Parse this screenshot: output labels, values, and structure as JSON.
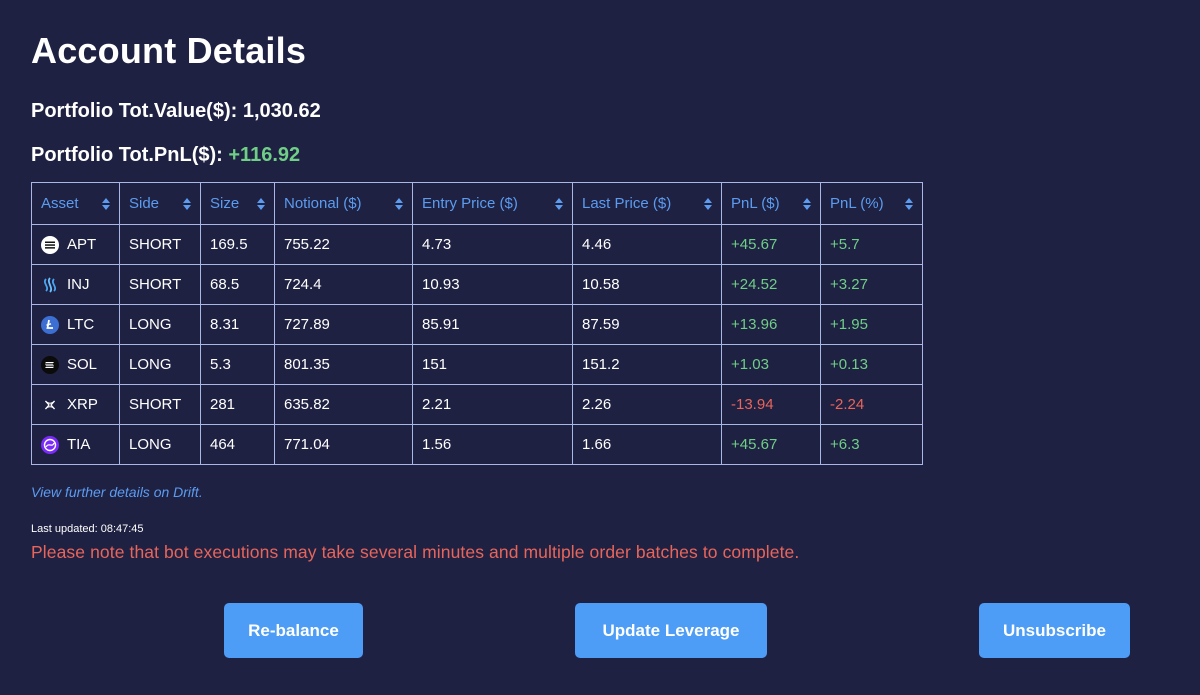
{
  "page": {
    "title": "Account Details",
    "portfolio_value_label": "Portfolio Tot.Value($):",
    "portfolio_value": "1,030.62",
    "portfolio_pnl_label": "Portfolio Tot.PnL($):",
    "portfolio_pnl": "+116.92"
  },
  "table": {
    "headers": [
      "Asset",
      "Side",
      "Size",
      "Notional ($)",
      "Entry Price ($)",
      "Last Price ($)",
      "PnL ($)",
      "PnL (%)"
    ],
    "rows": [
      {
        "asset": "APT",
        "icon": "aptos-icon",
        "side": "SHORT",
        "size": "169.5",
        "notional": "755.22",
        "entry": "4.73",
        "last": "4.46",
        "pnl": "+45.67",
        "pnl_pct": "+5.7",
        "pnl_status": "pos"
      },
      {
        "asset": "INJ",
        "icon": "injective-icon",
        "side": "SHORT",
        "size": "68.5",
        "notional": "724.4",
        "entry": "10.93",
        "last": "10.58",
        "pnl": "+24.52",
        "pnl_pct": "+3.27",
        "pnl_status": "pos"
      },
      {
        "asset": "LTC",
        "icon": "litecoin-icon",
        "side": "LONG",
        "size": "8.31",
        "notional": "727.89",
        "entry": "85.91",
        "last": "87.59",
        "pnl": "+13.96",
        "pnl_pct": "+1.95",
        "pnl_status": "pos"
      },
      {
        "asset": "SOL",
        "icon": "solana-icon",
        "side": "LONG",
        "size": "5.3",
        "notional": "801.35",
        "entry": "151",
        "last": "151.2",
        "pnl": "+1.03",
        "pnl_pct": "+0.13",
        "pnl_status": "pos"
      },
      {
        "asset": "XRP",
        "icon": "xrp-icon",
        "side": "SHORT",
        "size": "281",
        "notional": "635.82",
        "entry": "2.21",
        "last": "2.26",
        "pnl": "-13.94",
        "pnl_pct": "-2.24",
        "pnl_status": "neg"
      },
      {
        "asset": "TIA",
        "icon": "celestia-icon",
        "side": "LONG",
        "size": "464",
        "notional": "771.04",
        "entry": "1.56",
        "last": "1.66",
        "pnl": "+45.67",
        "pnl_pct": "+6.3",
        "pnl_status": "pos"
      }
    ]
  },
  "links": {
    "drift": "View further details on Drift."
  },
  "status": {
    "last_updated": "Last updated: 08:47:45",
    "notice": "Please note that bot executions may take several minutes and multiple order batches to complete."
  },
  "buttons": {
    "rebalance": "Re-balance",
    "update_leverage": "Update Leverage",
    "unsubscribe": "Unsubscribe"
  },
  "colors": {
    "background": "#1f2143",
    "accent": "#5b9cf0",
    "button": "#4d9cf6",
    "positive": "#6fcf86",
    "negative": "#e8655a"
  }
}
